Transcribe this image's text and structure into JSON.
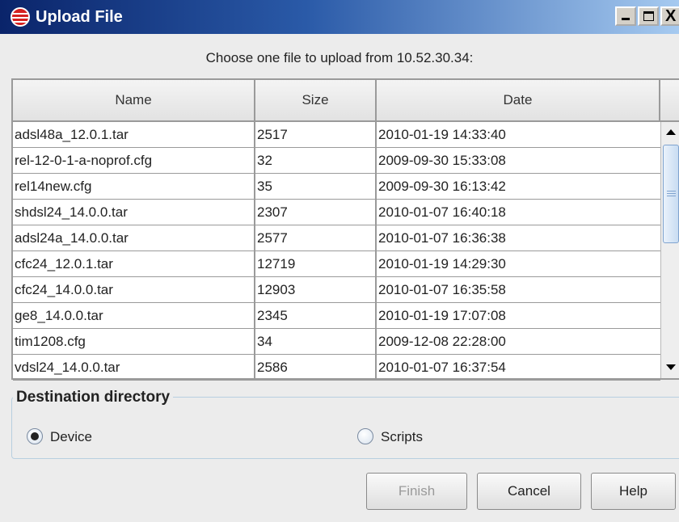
{
  "window": {
    "title": "Upload File",
    "controls": {
      "minimize": "_",
      "maximize": "□",
      "close": "X"
    }
  },
  "prompt": "Choose one file to upload from 10.52.30.34:",
  "table": {
    "columns": [
      "Name",
      "Size",
      "Date"
    ],
    "rows": [
      {
        "name": "adsl48a_12.0.1.tar",
        "size": "2517",
        "date": "2010-01-19 14:33:40"
      },
      {
        "name": "rel-12-0-1-a-noprof.cfg",
        "size": "32",
        "date": "2009-09-30 15:33:08"
      },
      {
        "name": "rel14new.cfg",
        "size": "35",
        "date": "2009-09-30 16:13:42"
      },
      {
        "name": "shdsl24_14.0.0.tar",
        "size": "2307",
        "date": "2010-01-07 16:40:18"
      },
      {
        "name": "adsl24a_14.0.0.tar",
        "size": "2577",
        "date": "2010-01-07 16:36:38"
      },
      {
        "name": "cfc24_12.0.1.tar",
        "size": "12719",
        "date": "2010-01-19 14:29:30"
      },
      {
        "name": "cfc24_14.0.0.tar",
        "size": "12903",
        "date": "2010-01-07 16:35:58"
      },
      {
        "name": "ge8_14.0.0.tar",
        "size": "2345",
        "date": "2010-01-19 17:07:08"
      },
      {
        "name": "tim1208.cfg",
        "size": "34",
        "date": "2009-12-08 22:28:00"
      },
      {
        "name": "vdsl24_14.0.0.tar",
        "size": "2586",
        "date": "2010-01-07 16:37:54"
      }
    ]
  },
  "destination": {
    "legend": "Destination directory",
    "options": [
      {
        "label": "Device",
        "selected": true
      },
      {
        "label": "Scripts",
        "selected": false
      }
    ]
  },
  "buttons": {
    "finish": "Finish",
    "cancel": "Cancel",
    "help": "Help"
  },
  "colors": {
    "titlebar_start": "#0a246a",
    "titlebar_end": "#a6caf0",
    "dialog_bg": "#ececec",
    "disabled_text": "#9a9a9a"
  }
}
